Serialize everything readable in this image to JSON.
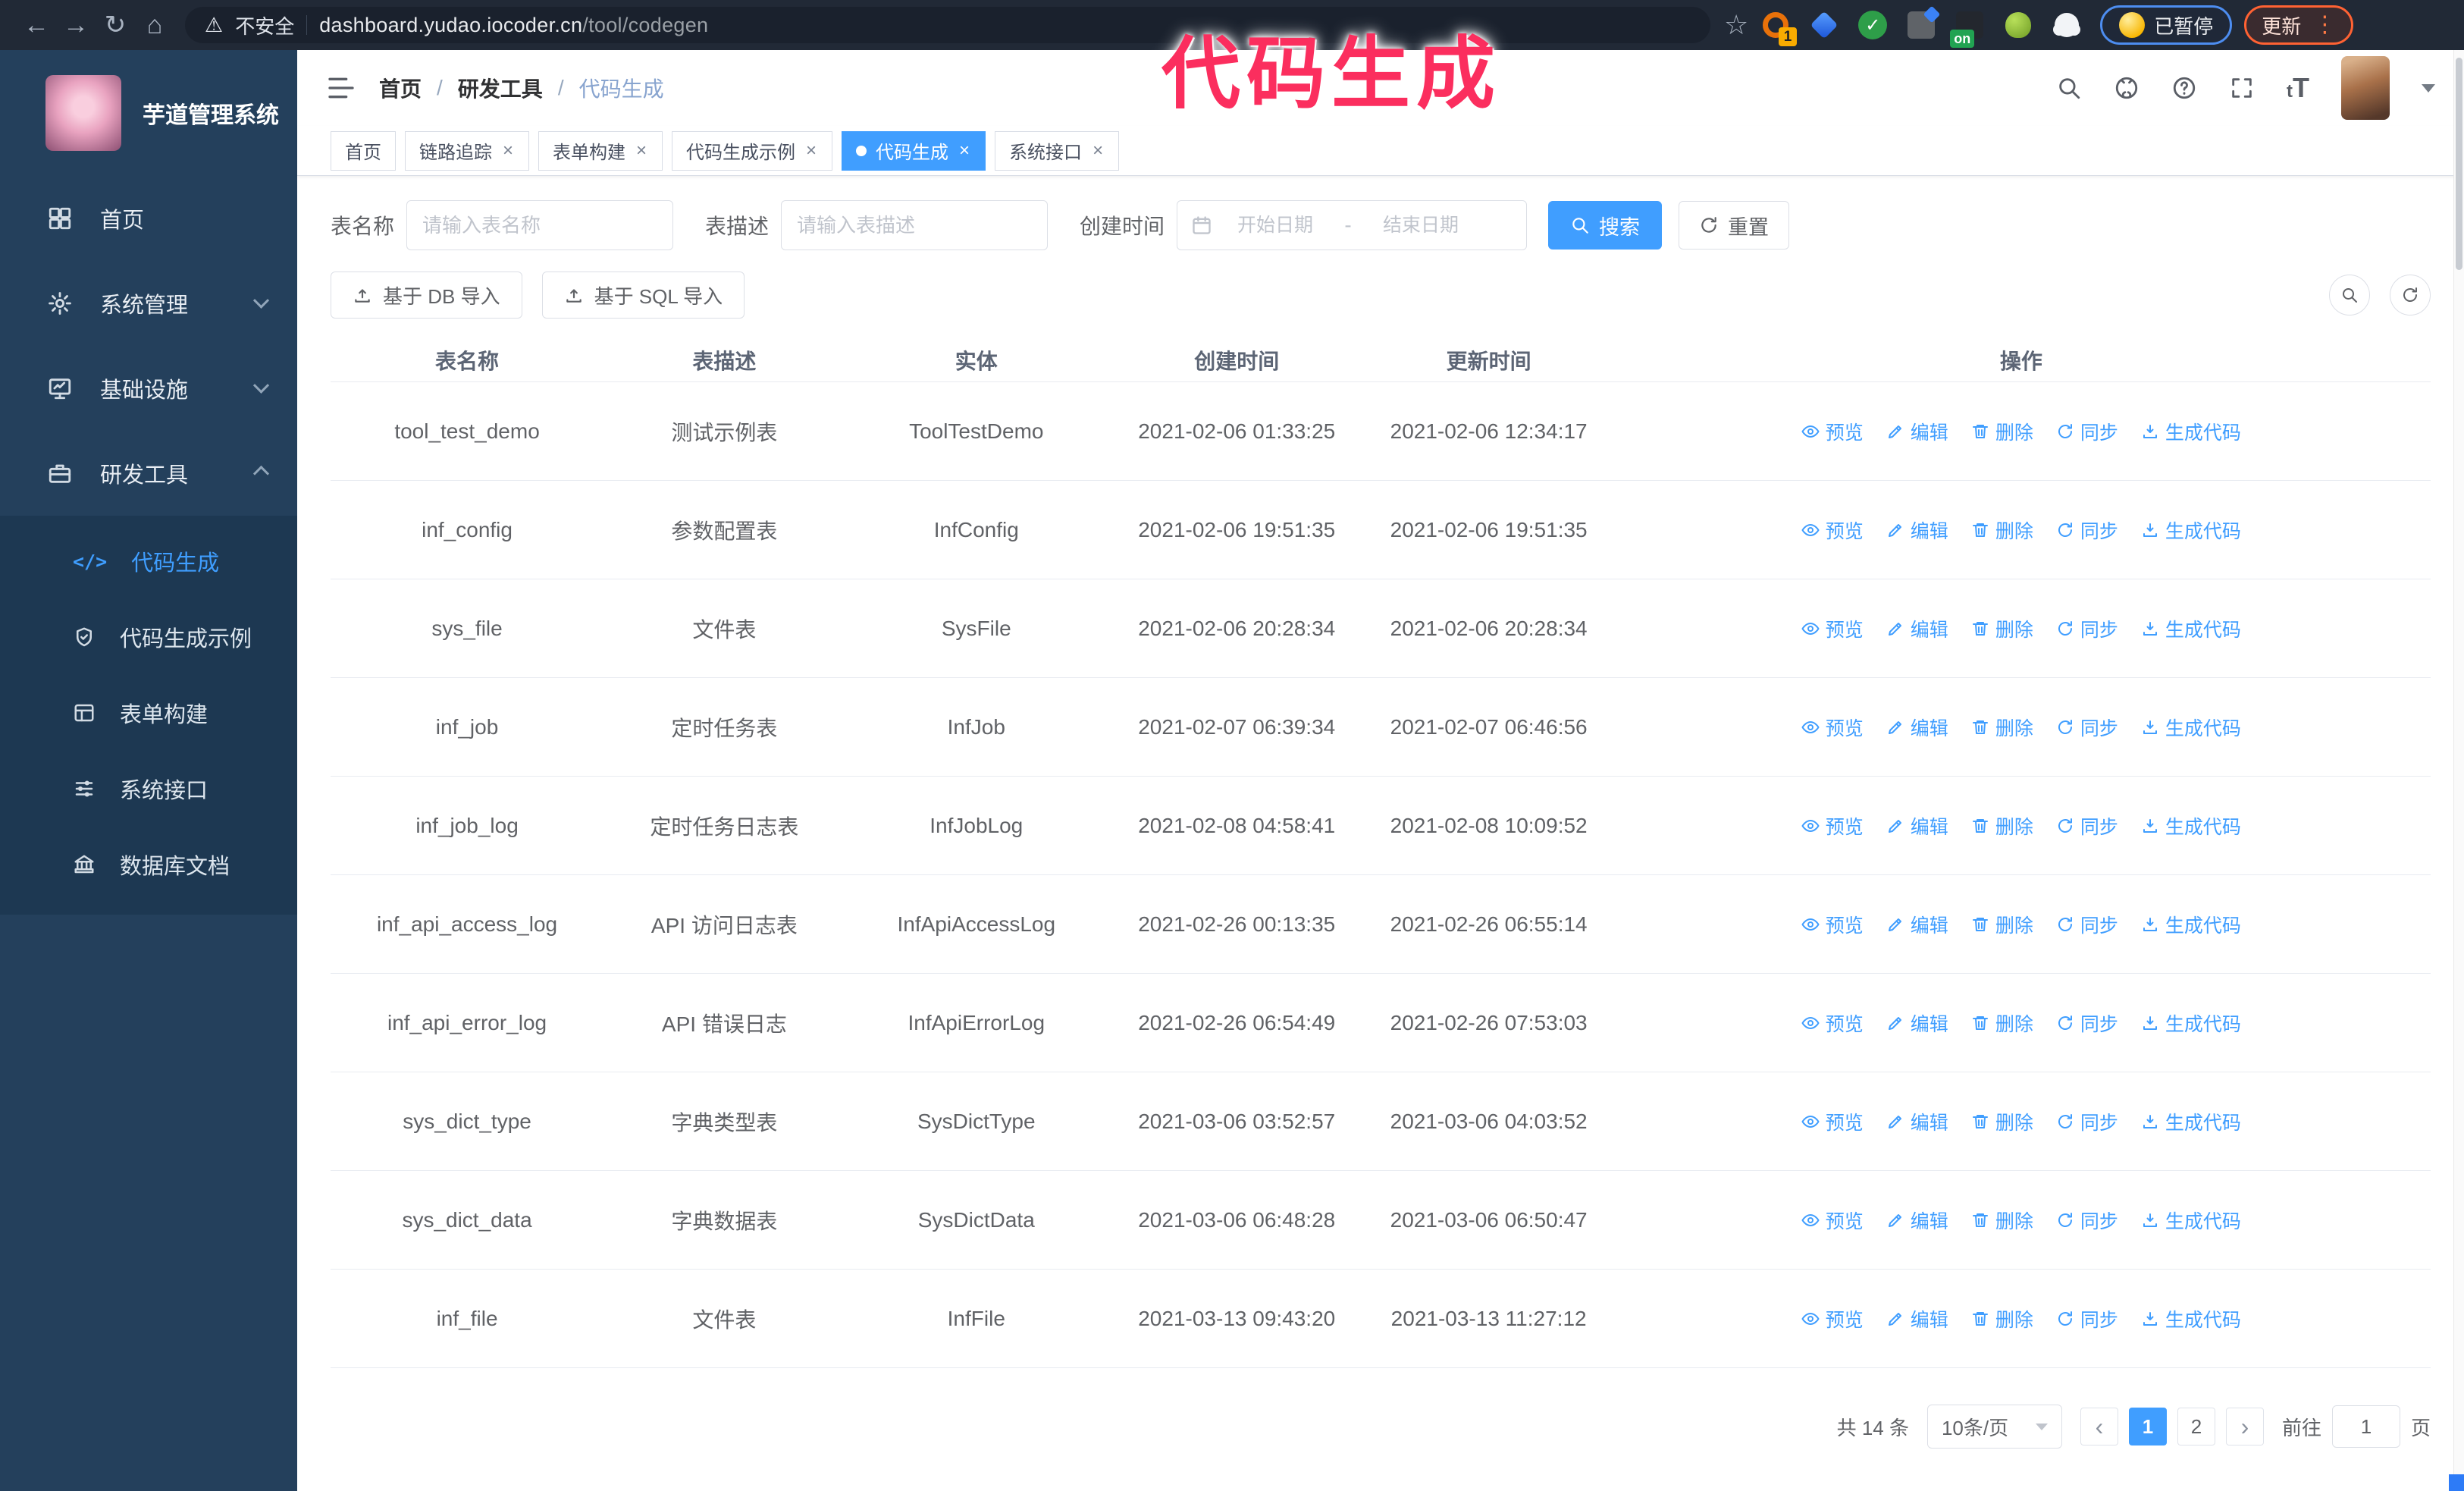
{
  "browser": {
    "security_label": "不安全",
    "url_domain": "dashboard.yudao.iocoder.cn",
    "url_path": "/tool/codegen",
    "extension_badge": "1",
    "extension_on_badge": "on",
    "paused_badge": "已暂停",
    "update_button": "更新"
  },
  "annotation": {
    "text": "代码生成",
    "color": "#fb2e5e"
  },
  "sidebar": {
    "logo_title": "芋道管理系统",
    "menu": [
      {
        "label": "首页"
      },
      {
        "label": "系统管理"
      },
      {
        "label": "基础设施"
      },
      {
        "label": "研发工具"
      }
    ],
    "submenu": [
      {
        "label": "代码生成"
      },
      {
        "label": "代码生成示例"
      },
      {
        "label": "表单构建"
      },
      {
        "label": "系统接口"
      },
      {
        "label": "数据库文档"
      }
    ]
  },
  "header": {
    "breadcrumb": {
      "home": "首页",
      "section": "研发工具",
      "current": "代码生成",
      "separator": "/"
    }
  },
  "tabs": [
    {
      "label": "首页"
    },
    {
      "label": "链路追踪"
    },
    {
      "label": "表单构建"
    },
    {
      "label": "代码生成示例"
    },
    {
      "label": "代码生成"
    },
    {
      "label": "系统接口"
    }
  ],
  "filters": {
    "name_label": "表名称",
    "name_placeholder": "请输入表名称",
    "desc_label": "表描述",
    "desc_placeholder": "请输入表描述",
    "time_label": "创建时间",
    "start_placeholder": "开始日期",
    "end_placeholder": "结束日期",
    "search_label": "搜索",
    "reset_label": "重置"
  },
  "toolbar": {
    "import_db_label": "基于 DB 导入",
    "import_sql_label": "基于 SQL 导入"
  },
  "table": {
    "columns": {
      "name": "表名称",
      "desc": "表描述",
      "entity": "实体",
      "created": "创建时间",
      "updated": "更新时间",
      "actions": "操作"
    },
    "action_labels": {
      "preview": "预览",
      "edit": "编辑",
      "delete": "删除",
      "sync": "同步",
      "generate": "生成代码"
    },
    "rows": [
      {
        "name": "tool_test_demo",
        "desc": "测试示例表",
        "entity": "ToolTestDemo",
        "created": "2021-02-06 01:33:25",
        "updated": "2021-02-06 12:34:17"
      },
      {
        "name": "inf_config",
        "desc": "参数配置表",
        "entity": "InfConfig",
        "created": "2021-02-06 19:51:35",
        "updated": "2021-02-06 19:51:35"
      },
      {
        "name": "sys_file",
        "desc": "文件表",
        "entity": "SysFile",
        "created": "2021-02-06 20:28:34",
        "updated": "2021-02-06 20:28:34"
      },
      {
        "name": "inf_job",
        "desc": "定时任务表",
        "entity": "InfJob",
        "created": "2021-02-07 06:39:34",
        "updated": "2021-02-07 06:46:56"
      },
      {
        "name": "inf_job_log",
        "desc": "定时任务日志表",
        "entity": "InfJobLog",
        "created": "2021-02-08 04:58:41",
        "updated": "2021-02-08 10:09:52"
      },
      {
        "name": "inf_api_access_log",
        "desc": "API 访问日志表",
        "entity": "InfApiAccessLog",
        "created": "2021-02-26 00:13:35",
        "updated": "2021-02-26 06:55:14"
      },
      {
        "name": "inf_api_error_log",
        "desc": "API 错误日志",
        "entity": "InfApiErrorLog",
        "created": "2021-02-26 06:54:49",
        "updated": "2021-02-26 07:53:03"
      },
      {
        "name": "sys_dict_type",
        "desc": "字典类型表",
        "entity": "SysDictType",
        "created": "2021-03-06 03:52:57",
        "updated": "2021-03-06 04:03:52"
      },
      {
        "name": "sys_dict_data",
        "desc": "字典数据表",
        "entity": "SysDictData",
        "created": "2021-03-06 06:48:28",
        "updated": "2021-03-06 06:50:47"
      },
      {
        "name": "inf_file",
        "desc": "文件表",
        "entity": "InfFile",
        "created": "2021-03-13 09:43:20",
        "updated": "2021-03-13 11:27:12"
      }
    ]
  },
  "pagination": {
    "total": "共 14 条",
    "page_size": "10条/页",
    "page_1": "1",
    "page_2": "2",
    "goto_label": "前往",
    "goto_value": "1",
    "goto_suffix": "页"
  },
  "icons": {
    "back": "←",
    "forward": "→",
    "reload": "↻",
    "home": "⌂",
    "warning": "⚠",
    "star": "☆",
    "close": "×",
    "menu_dots": "⋮",
    "check": "✓",
    "code": "</>",
    "font_size": "tT",
    "prev": "‹",
    "next": "›",
    "date_separator": "-"
  },
  "colors": {
    "primary": "#409eff",
    "sidebar_bg": "#24405c",
    "submenu_bg": "#1d3852",
    "chrome_bg": "#212936",
    "annotation": "#fb2e5e"
  }
}
